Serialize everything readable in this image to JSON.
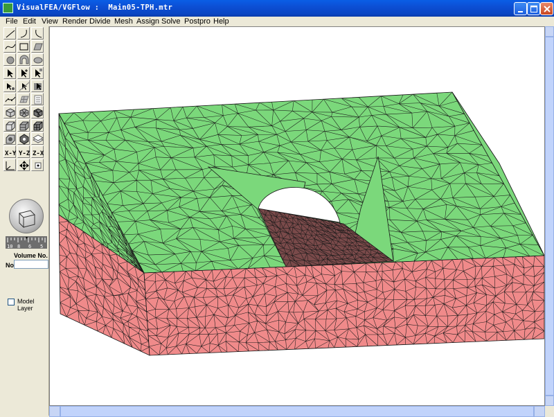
{
  "window": {
    "title": "VisualFEA/VGFlow :  Main05-TPH.mtr",
    "controls": {
      "minimize": "minimize-icon",
      "maximize": "maximize-icon",
      "close": "close-icon"
    }
  },
  "menu": [
    "File",
    "Edit",
    "View",
    "Render",
    "Divide",
    "Mesh",
    "Assign",
    "Solve",
    "Postpro",
    "Help"
  ],
  "toolbar": {
    "icons": [
      "line-icon",
      "arc-icon",
      "arc-ccw-icon",
      "spline-icon",
      "rectangle-icon",
      "surface-icon",
      "circle-solid-icon",
      "tunnel-arch-icon",
      "ellipse-surface-icon",
      "pointer-icon",
      "pointer-add-icon",
      "pointer-select-icon",
      "node-select-icon",
      "edge-select-icon",
      "face-select-icon",
      "curve-divide-icon",
      "surface-divide-icon",
      "table-icon",
      "mesh-node-icon",
      "mesh-surface-icon",
      "mesh-solid-icon",
      "cube-icon",
      "cube-slice-icon",
      "cube-mesh-icon",
      "render-icon",
      "assign-icon",
      "layer-icon",
      "view-xy-icon",
      "view-yz-icon",
      "view-zx-icon",
      "axis-icon",
      "move-icon",
      "fit-icon"
    ],
    "view_labels": {
      "xy": "X-Y",
      "yz": "Y-Z",
      "zx": "Z-X"
    },
    "gauge_labels": [
      "10",
      "8",
      "6",
      "5"
    ],
    "volume_label": "Volume No.",
    "no_label": "No",
    "no_value": "",
    "model_layer_label": "Model Layer",
    "model_layer_checked": false
  },
  "colors": {
    "ground_top": "#7bd87b",
    "ground_bottom": "#f08a8a",
    "tunnel_floor": "#7a4a4a",
    "mesh_line": "#1a1a1a"
  }
}
